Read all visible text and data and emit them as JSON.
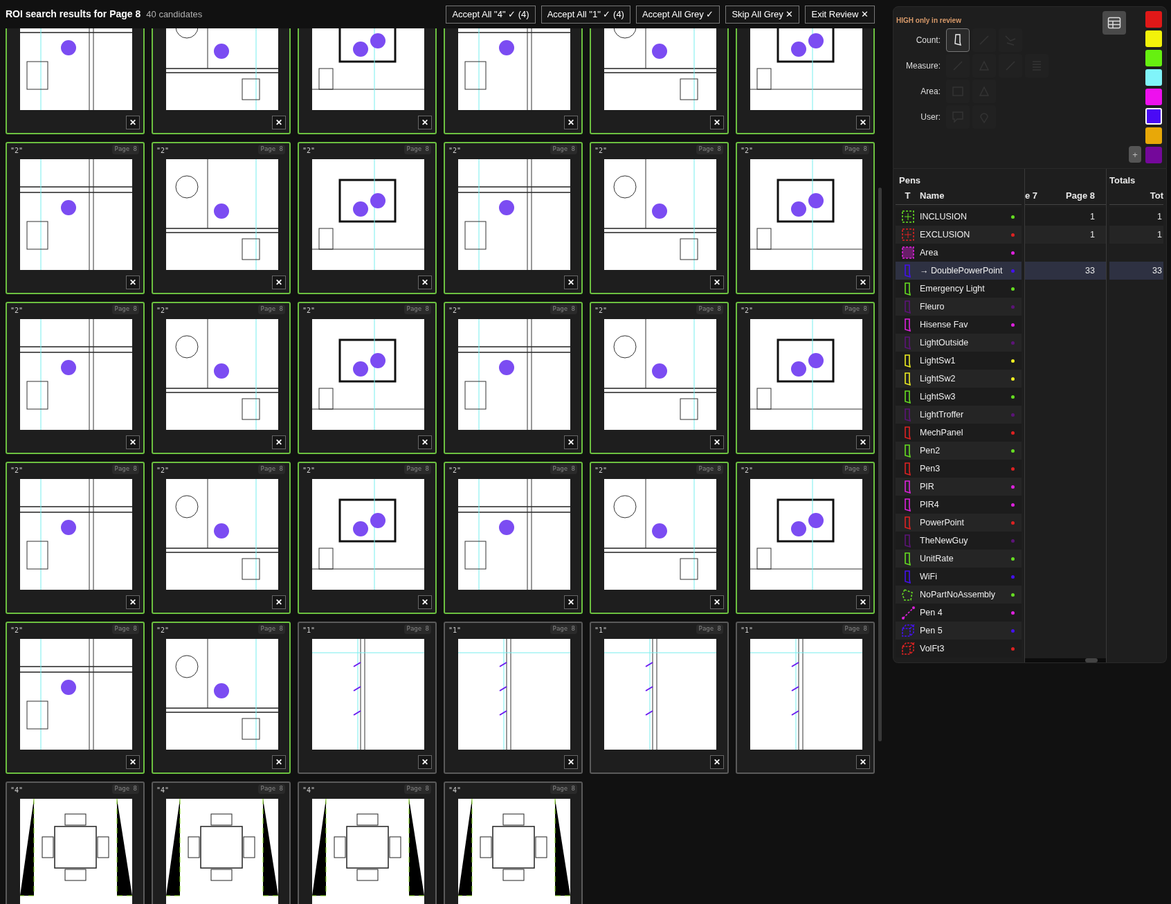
{
  "header": {
    "title": "ROI search results for Page 8",
    "count": "40 candidates",
    "actions": [
      {
        "label": "Accept All \"4\" ✓ (4)"
      },
      {
        "label": "Accept All \"1\" ✓ (4)"
      },
      {
        "label": "Accept All Grey ✓"
      },
      {
        "label": "Skip All Grey ✕"
      },
      {
        "label": "Exit Review ✕"
      }
    ]
  },
  "cards": [
    {
      "accepted": true,
      "close": "✕"
    },
    {
      "accepted": true,
      "close": "✕"
    },
    {
      "accepted": true,
      "close": "✕"
    },
    {
      "accepted": true,
      "close": "✕"
    },
    {
      "accepted": true,
      "close": "✕"
    },
    {
      "accepted": true,
      "close": "✕"
    },
    {
      "label": "\"2\"",
      "page": "Page 8",
      "accepted": true,
      "close": "✕"
    },
    {
      "label": "\"2\"",
      "page": "Page 8",
      "accepted": true,
      "close": "✕"
    },
    {
      "label": "\"2\"",
      "page": "Page 8",
      "accepted": true,
      "close": "✕"
    },
    {
      "label": "\"2\"",
      "page": "Page 8",
      "accepted": true,
      "close": "✕"
    },
    {
      "label": "\"2\"",
      "page": "Page 8",
      "accepted": true,
      "close": "✕"
    },
    {
      "label": "\"2\"",
      "page": "Page 8",
      "accepted": true,
      "close": "✕"
    },
    {
      "label": "\"2\"",
      "page": "Page 8",
      "accepted": true,
      "close": "✕"
    },
    {
      "label": "\"2\"",
      "page": "Page 8",
      "accepted": true,
      "close": "✕"
    },
    {
      "label": "\"2\"",
      "page": "Page 8",
      "accepted": true,
      "close": "✕"
    },
    {
      "label": "\"2\"",
      "page": "Page 8",
      "accepted": true,
      "close": "✕"
    },
    {
      "label": "\"2\"",
      "page": "Page 8",
      "accepted": true,
      "close": "✕"
    },
    {
      "label": "\"2\"",
      "page": "Page 8",
      "accepted": true,
      "close": "✕"
    },
    {
      "label": "\"2\"",
      "page": "Page 8",
      "accepted": true,
      "close": "✕"
    },
    {
      "label": "\"2\"",
      "page": "Page 8",
      "accepted": true,
      "close": "✕"
    },
    {
      "label": "\"2\"",
      "page": "Page 8",
      "accepted": true,
      "close": "✕"
    },
    {
      "label": "\"2\"",
      "page": "Page 8",
      "accepted": true,
      "close": "✕"
    },
    {
      "label": "\"2\"",
      "page": "Page 8",
      "accepted": true,
      "close": "✕"
    },
    {
      "label": "\"2\"",
      "page": "Page 8",
      "accepted": true,
      "close": "✕"
    },
    {
      "label": "\"2\"",
      "page": "Page 8",
      "accepted": true,
      "close": "✕"
    },
    {
      "label": "\"2\"",
      "page": "Page 8",
      "accepted": true,
      "close": "✕"
    },
    {
      "label": "\"1\"",
      "page": "Page 8",
      "accepted": false,
      "close": "✕"
    },
    {
      "label": "\"1\"",
      "page": "Page 8",
      "accepted": false,
      "close": "✕"
    },
    {
      "label": "\"1\"",
      "page": "Page 8",
      "accepted": false,
      "close": "✕"
    },
    {
      "label": "\"1\"",
      "page": "Page 8",
      "accepted": false,
      "close": "✕"
    },
    {
      "label": "\"4\"",
      "page": "Page 8",
      "accepted": false
    },
    {
      "label": "\"4\"",
      "page": "Page 8",
      "accepted": false
    },
    {
      "label": "\"4\"",
      "page": "Page 8",
      "accepted": false
    },
    {
      "label": "\"4\"",
      "page": "Page 8",
      "accepted": false
    }
  ],
  "tools": {
    "note": "HIGH only in review",
    "groups": [
      {
        "label": "Count:",
        "items": [
          {
            "kind": "marker",
            "selected": true,
            "disabled": false
          },
          {
            "kind": "line",
            "selected": false,
            "disabled": true
          },
          {
            "kind": "polyline",
            "selected": false,
            "disabled": true
          }
        ]
      },
      {
        "label": "Measure:",
        "items": [
          {
            "kind": "line",
            "selected": false,
            "disabled": true
          },
          {
            "kind": "angle",
            "selected": false,
            "disabled": true
          },
          {
            "kind": "line",
            "selected": false,
            "disabled": true
          },
          {
            "kind": "list",
            "selected": false,
            "disabled": true
          }
        ]
      },
      {
        "label": "Area:",
        "items": [
          {
            "kind": "rect",
            "selected": false,
            "disabled": true
          },
          {
            "kind": "angle",
            "selected": false,
            "disabled": true
          }
        ]
      },
      {
        "label": "User:",
        "items": [
          {
            "kind": "comment",
            "selected": false,
            "disabled": true
          },
          {
            "kind": "pin",
            "selected": false,
            "disabled": true
          }
        ]
      }
    ],
    "swatches": [
      {
        "color": "#e01818",
        "selected": false
      },
      {
        "color": "#f2f20a",
        "selected": false
      },
      {
        "color": "#66f010",
        "selected": false
      },
      {
        "color": "#80f4fa",
        "selected": false
      },
      {
        "color": "#ee10ee",
        "selected": false
      },
      {
        "color": "#4a0af5",
        "selected": true
      },
      {
        "color": "#e8a808",
        "selected": false
      },
      {
        "color": "#74089a",
        "selected": false
      }
    ],
    "add": "+"
  },
  "pens": {
    "title": "Pens",
    "totals_title": "Totals",
    "columns": [
      "T",
      "Name",
      "e 7",
      "Page 8",
      "Tot"
    ],
    "rows": [
      {
        "kind": "inclusion",
        "name": "INCLUSION",
        "color": "#66dd22",
        "selected": false,
        "page8": "1",
        "total": "1"
      },
      {
        "kind": "exclusion",
        "name": "EXCLUSION",
        "color": "#dd2222",
        "selected": false,
        "page8": "1",
        "total": "1"
      },
      {
        "kind": "area",
        "name": "Area",
        "color": "#dd22dd",
        "selected": false
      },
      {
        "kind": "count",
        "name": "→ DoublePowerPoint",
        "color": "#4411ee",
        "selected": true,
        "page8": "33",
        "total": "33"
      },
      {
        "kind": "count",
        "name": "Emergency Light",
        "color": "#66dd22",
        "selected": false
      },
      {
        "kind": "count",
        "name": "Fleuro",
        "color": "#5c1478",
        "selected": false
      },
      {
        "kind": "count",
        "name": "Hisense Fav",
        "color": "#dd22dd",
        "selected": false
      },
      {
        "kind": "count",
        "name": "LightOutside",
        "color": "#5c1478",
        "selected": false
      },
      {
        "kind": "count",
        "name": "LightSw1",
        "color": "#eeee22",
        "selected": false
      },
      {
        "kind": "count",
        "name": "LightSw2",
        "color": "#eeee22",
        "selected": false
      },
      {
        "kind": "count",
        "name": "LightSw3",
        "color": "#66dd22",
        "selected": false
      },
      {
        "kind": "count",
        "name": "LightTroffer",
        "color": "#5c1478",
        "selected": false
      },
      {
        "kind": "count",
        "name": "MechPanel",
        "color": "#dd2222",
        "selected": false
      },
      {
        "kind": "count",
        "name": "Pen2",
        "color": "#66dd22",
        "selected": false
      },
      {
        "kind": "count",
        "name": "Pen3",
        "color": "#dd2222",
        "selected": false
      },
      {
        "kind": "count",
        "name": "PIR",
        "color": "#dd22dd",
        "selected": false
      },
      {
        "kind": "count",
        "name": "PIR4",
        "color": "#dd22dd",
        "selected": false
      },
      {
        "kind": "count",
        "name": "PowerPoint",
        "color": "#dd2222",
        "selected": false
      },
      {
        "kind": "count",
        "name": "TheNewGuy",
        "color": "#5c1478",
        "selected": false
      },
      {
        "kind": "count",
        "name": "UnitRate",
        "color": "#66dd22",
        "selected": false
      },
      {
        "kind": "count",
        "name": "WiFi",
        "color": "#4411ee",
        "selected": false
      },
      {
        "kind": "polygon",
        "name": "NoPartNoAssembly",
        "color": "#66dd22",
        "selected": false
      },
      {
        "kind": "line",
        "name": "Pen 4",
        "color": "#dd22dd",
        "selected": false
      },
      {
        "kind": "volume",
        "name": "Pen 5",
        "color": "#4411ee",
        "selected": false
      },
      {
        "kind": "volume",
        "name": "VolFt3",
        "color": "#dd2222",
        "selected": false
      }
    ]
  }
}
